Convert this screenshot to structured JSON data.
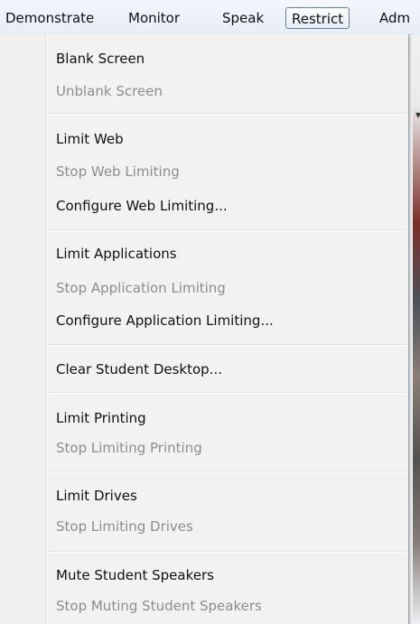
{
  "menubar": {
    "items": [
      {
        "label": "Demonstrate"
      },
      {
        "label": "Monitor"
      },
      {
        "label": "Speak"
      },
      {
        "label": "Restrict"
      },
      {
        "label": "Adm"
      }
    ]
  },
  "restrict_menu": {
    "items": [
      {
        "label": "Blank Screen",
        "enabled": true
      },
      {
        "label": "Unblank Screen",
        "enabled": false
      },
      {
        "label": "Limit Web",
        "enabled": true
      },
      {
        "label": "Stop Web Limiting",
        "enabled": false
      },
      {
        "label": "Configure Web Limiting...",
        "enabled": true
      },
      {
        "label": "Limit Applications",
        "enabled": true
      },
      {
        "label": "Stop Application Limiting",
        "enabled": false
      },
      {
        "label": "Configure Application Limiting...",
        "enabled": true
      },
      {
        "label": "Clear Student Desktop...",
        "enabled": true
      },
      {
        "label": "Limit Printing",
        "enabled": true
      },
      {
        "label": "Stop Limiting Printing",
        "enabled": false
      },
      {
        "label": "Limit Drives",
        "enabled": true
      },
      {
        "label": "Stop Limiting Drives",
        "enabled": false
      },
      {
        "label": "Mute Student Speakers",
        "enabled": true
      },
      {
        "label": "Stop Muting Student Speakers",
        "enabled": false
      }
    ]
  },
  "colors": {
    "enabled_text": "#101010",
    "disabled_text": "#8d8d8d",
    "menu_background": "#f2f2f2"
  }
}
